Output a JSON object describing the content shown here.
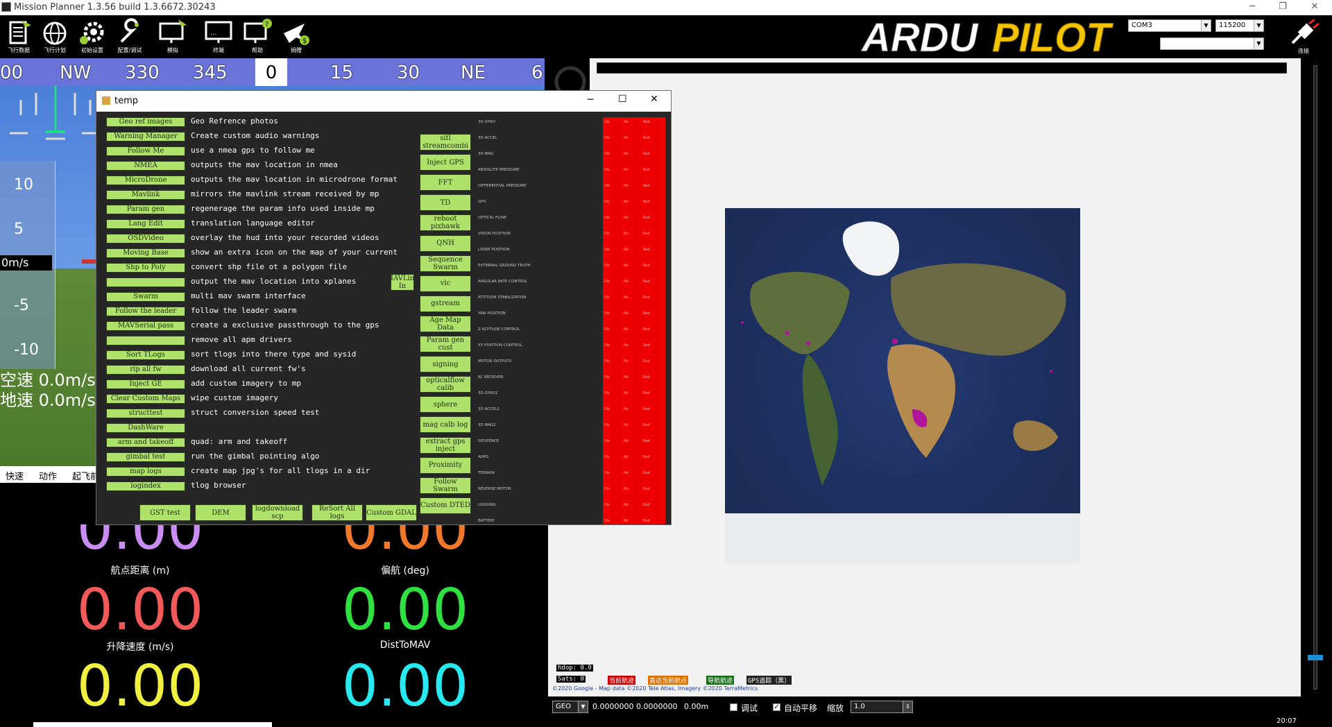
{
  "window": {
    "title": "Mission Planner 1.3.56 build 1.3.6672.30243"
  },
  "toolbar": {
    "items": [
      "飞行数据",
      "飞行计划",
      "初始设置",
      "配置/调试",
      "模拟",
      "终端",
      "帮助",
      "捐赠"
    ],
    "com_port": "COM3",
    "baud": "115200",
    "connect_label": "连接"
  },
  "logo": {
    "ardu": "ARDU",
    "pilot": "PILOT"
  },
  "compass": {
    "labels": [
      "00",
      "NW",
      "330",
      "345",
      "0",
      "15",
      "30",
      "NE",
      "6"
    ]
  },
  "hud": {
    "speed_ticks": [
      "10",
      "5",
      "-5",
      "-10"
    ],
    "speed_box": "0m/s",
    "airspeed": "空速 0.0m/s",
    "groundspeed": "地速 0.0m/s"
  },
  "tabs": [
    "快速",
    "动作",
    "起飞前"
  ],
  "quick": [
    {
      "value": "0.00",
      "label": "航点距离 (m)",
      "color": "#c98cf2"
    },
    {
      "value": "0.00",
      "label": "偏航 (deg)",
      "color": "#f0782a"
    },
    {
      "value": "0.00",
      "label": "升降速度 (m/s)",
      "color": "#f25a5a"
    },
    {
      "value": "0.00",
      "label": "DistToMAV",
      "color": "#2ee040"
    },
    {
      "value": "0.00",
      "label": "",
      "color": "#f0f040"
    },
    {
      "value": "0.00",
      "label": "",
      "color": "#28e8f0"
    }
  ],
  "temp": {
    "title": "temp",
    "buttons": [
      {
        "label": "Geo ref images",
        "desc": "Geo Refrence photos"
      },
      {
        "label": "Warning Manager",
        "desc": "Create custom audio warnings"
      },
      {
        "label": "Follow Me",
        "desc": "use a nmea gps to follow me"
      },
      {
        "label": "NMEA",
        "desc": "outputs the mav location in nmea"
      },
      {
        "label": "MicroDrone",
        "desc": "outputs the mav location in microdrone format"
      },
      {
        "label": "Mavlink",
        "desc": "mirrors the mavlink stream received by mp"
      },
      {
        "label": "Param gen",
        "desc": "regenerage the param info used inside mp"
      },
      {
        "label": "Lang Edit",
        "desc": "translation language editor"
      },
      {
        "label": "OSDVideo",
        "desc": "overlay the hud into your recorded videos"
      },
      {
        "label": "Moving Base",
        "desc": "show an extra icon on the map of your current"
      },
      {
        "label": "Shp to Poly",
        "desc": "convert shp file ot a polygon file"
      },
      {
        "label": "",
        "desc": "output the mav location into xplanes"
      },
      {
        "label": "Swarm",
        "desc": "multi mav swarm interface"
      },
      {
        "label": "Follow the leader",
        "desc": "follow the leader swarm"
      },
      {
        "label": "MAVSerial pass",
        "desc": "create a exclusive passthrough to the gps"
      },
      {
        "label": "",
        "desc": "remove all apm drivers"
      },
      {
        "label": "Sort TLogs",
        "desc": "sort tlogs into there type and sysid"
      },
      {
        "label": "rip all fw",
        "desc": "download all current fw's"
      },
      {
        "label": "Inject GE",
        "desc": "add custom imagery to mp"
      },
      {
        "label": "Clear Custom Maps",
        "desc": "wipe custom imagery"
      },
      {
        "label": "structtest",
        "desc": "struct conversion speed test"
      },
      {
        "label": "DashWare",
        "desc": ""
      },
      {
        "label": "arm and takeoff",
        "desc": "quad: arm and takeoff"
      },
      {
        "label": "gimbal test",
        "desc": "run the gimbal pointing algo"
      },
      {
        "label": "map logs",
        "desc": "create map jpg's for all tlogs in a dir"
      },
      {
        "label": "logindex",
        "desc": "tlog browser"
      }
    ],
    "mavlink_in": "MAVLink In",
    "col2": [
      "sitl streamcombi",
      "Inject GPS",
      "FFT",
      "TD",
      "reboot pixhawk",
      "QNH",
      "Sequence Swarm",
      "vlc",
      "gstream",
      "Age Map Data",
      "Param gen cust",
      "signing",
      "opticalflow calib",
      "sphere",
      "mag calb log",
      "extract gps inject",
      "Proximity",
      "Follow Swarm",
      "Custom DTED"
    ],
    "bottom": [
      "GST test",
      "DEM",
      "logdownload scp",
      "ReSort All logs",
      "Custom GDAL"
    ],
    "sensors": [
      "3D GYRO",
      "3D ACCEL",
      "3D MAG",
      "ABSOLUTE PRESSURE",
      "DIFFERENTIAL PRESSURE",
      "GPS",
      "OPTICAL FLOW",
      "VISION POSITION",
      "LASER POSITION",
      "EXTERNAL GROUND TRUTH",
      "ANGULAR RATE CONTROL",
      "ATTITUDE STABILIZATION",
      "YAW POSITION",
      "Z ALTITUDE CONTROL",
      "XY POSITION CONTROL",
      "MOTOR OUTPUTS",
      "RC RECEIVER",
      "3D GYRO2",
      "3D ACCEL2",
      "3D MAG2",
      "GEOFENCE",
      "AHRS",
      "TERRAIN",
      "REVERSE MOTOR",
      "LOGGING",
      "BATTERY"
    ],
    "status": [
      "Dis",
      "No",
      "Bad"
    ]
  },
  "map": {
    "hdop": "hdop: 0.0",
    "sats": "Sats: 0",
    "legend": [
      "当前航迹",
      "直达当前航点",
      "导航航迹",
      "GPS追踪（黑）"
    ],
    "copyright": "©2020 Google - Map data ©2020 Tele Atlas, Imagery ©2020 TerraMetrics",
    "coord_type": "GEO",
    "coords": "0.0000000 0.0000000",
    "alt": "0.00m",
    "debug_label": "调试",
    "autopan_label": "自动平移",
    "zoom_label": "缩放",
    "zoom_value": "1.0",
    "clock": "20:07"
  },
  "colors": {
    "accent_green": "#aee26a",
    "compass_blue": "#6a73d8",
    "status_red": "#e00000"
  }
}
